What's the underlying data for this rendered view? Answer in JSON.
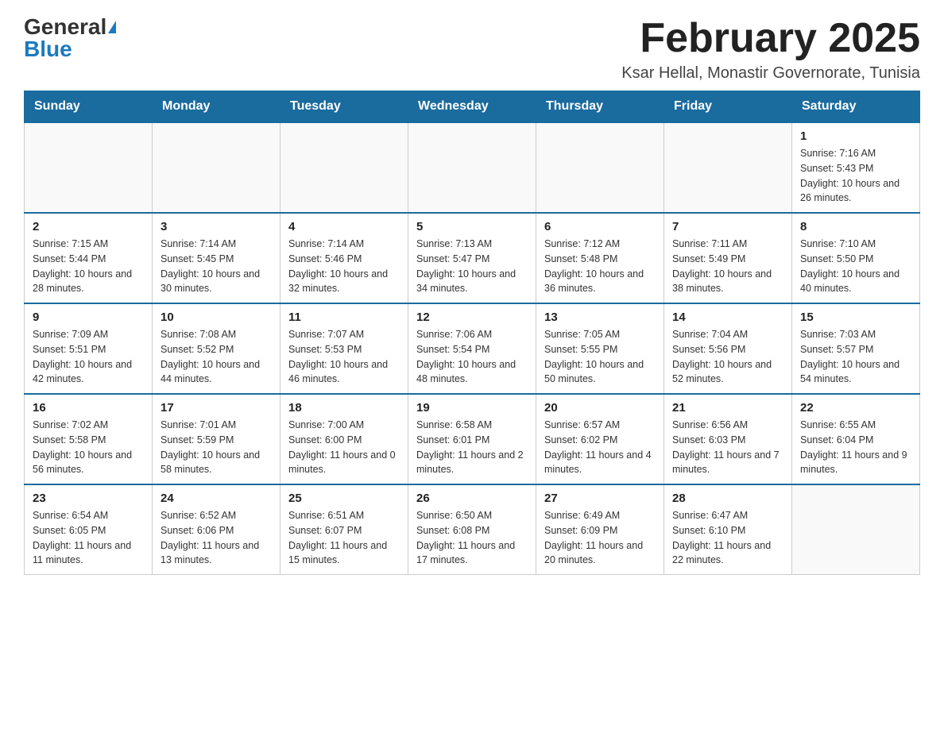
{
  "header": {
    "logo_general": "General",
    "logo_blue": "Blue",
    "month_year": "February 2025",
    "location": "Ksar Hellal, Monastir Governorate, Tunisia"
  },
  "days_of_week": [
    "Sunday",
    "Monday",
    "Tuesday",
    "Wednesday",
    "Thursday",
    "Friday",
    "Saturday"
  ],
  "weeks": [
    [
      {
        "day": "",
        "info": ""
      },
      {
        "day": "",
        "info": ""
      },
      {
        "day": "",
        "info": ""
      },
      {
        "day": "",
        "info": ""
      },
      {
        "day": "",
        "info": ""
      },
      {
        "day": "",
        "info": ""
      },
      {
        "day": "1",
        "info": "Sunrise: 7:16 AM\nSunset: 5:43 PM\nDaylight: 10 hours and 26 minutes."
      }
    ],
    [
      {
        "day": "2",
        "info": "Sunrise: 7:15 AM\nSunset: 5:44 PM\nDaylight: 10 hours and 28 minutes."
      },
      {
        "day": "3",
        "info": "Sunrise: 7:14 AM\nSunset: 5:45 PM\nDaylight: 10 hours and 30 minutes."
      },
      {
        "day": "4",
        "info": "Sunrise: 7:14 AM\nSunset: 5:46 PM\nDaylight: 10 hours and 32 minutes."
      },
      {
        "day": "5",
        "info": "Sunrise: 7:13 AM\nSunset: 5:47 PM\nDaylight: 10 hours and 34 minutes."
      },
      {
        "day": "6",
        "info": "Sunrise: 7:12 AM\nSunset: 5:48 PM\nDaylight: 10 hours and 36 minutes."
      },
      {
        "day": "7",
        "info": "Sunrise: 7:11 AM\nSunset: 5:49 PM\nDaylight: 10 hours and 38 minutes."
      },
      {
        "day": "8",
        "info": "Sunrise: 7:10 AM\nSunset: 5:50 PM\nDaylight: 10 hours and 40 minutes."
      }
    ],
    [
      {
        "day": "9",
        "info": "Sunrise: 7:09 AM\nSunset: 5:51 PM\nDaylight: 10 hours and 42 minutes."
      },
      {
        "day": "10",
        "info": "Sunrise: 7:08 AM\nSunset: 5:52 PM\nDaylight: 10 hours and 44 minutes."
      },
      {
        "day": "11",
        "info": "Sunrise: 7:07 AM\nSunset: 5:53 PM\nDaylight: 10 hours and 46 minutes."
      },
      {
        "day": "12",
        "info": "Sunrise: 7:06 AM\nSunset: 5:54 PM\nDaylight: 10 hours and 48 minutes."
      },
      {
        "day": "13",
        "info": "Sunrise: 7:05 AM\nSunset: 5:55 PM\nDaylight: 10 hours and 50 minutes."
      },
      {
        "day": "14",
        "info": "Sunrise: 7:04 AM\nSunset: 5:56 PM\nDaylight: 10 hours and 52 minutes."
      },
      {
        "day": "15",
        "info": "Sunrise: 7:03 AM\nSunset: 5:57 PM\nDaylight: 10 hours and 54 minutes."
      }
    ],
    [
      {
        "day": "16",
        "info": "Sunrise: 7:02 AM\nSunset: 5:58 PM\nDaylight: 10 hours and 56 minutes."
      },
      {
        "day": "17",
        "info": "Sunrise: 7:01 AM\nSunset: 5:59 PM\nDaylight: 10 hours and 58 minutes."
      },
      {
        "day": "18",
        "info": "Sunrise: 7:00 AM\nSunset: 6:00 PM\nDaylight: 11 hours and 0 minutes."
      },
      {
        "day": "19",
        "info": "Sunrise: 6:58 AM\nSunset: 6:01 PM\nDaylight: 11 hours and 2 minutes."
      },
      {
        "day": "20",
        "info": "Sunrise: 6:57 AM\nSunset: 6:02 PM\nDaylight: 11 hours and 4 minutes."
      },
      {
        "day": "21",
        "info": "Sunrise: 6:56 AM\nSunset: 6:03 PM\nDaylight: 11 hours and 7 minutes."
      },
      {
        "day": "22",
        "info": "Sunrise: 6:55 AM\nSunset: 6:04 PM\nDaylight: 11 hours and 9 minutes."
      }
    ],
    [
      {
        "day": "23",
        "info": "Sunrise: 6:54 AM\nSunset: 6:05 PM\nDaylight: 11 hours and 11 minutes."
      },
      {
        "day": "24",
        "info": "Sunrise: 6:52 AM\nSunset: 6:06 PM\nDaylight: 11 hours and 13 minutes."
      },
      {
        "day": "25",
        "info": "Sunrise: 6:51 AM\nSunset: 6:07 PM\nDaylight: 11 hours and 15 minutes."
      },
      {
        "day": "26",
        "info": "Sunrise: 6:50 AM\nSunset: 6:08 PM\nDaylight: 11 hours and 17 minutes."
      },
      {
        "day": "27",
        "info": "Sunrise: 6:49 AM\nSunset: 6:09 PM\nDaylight: 11 hours and 20 minutes."
      },
      {
        "day": "28",
        "info": "Sunrise: 6:47 AM\nSunset: 6:10 PM\nDaylight: 11 hours and 22 minutes."
      },
      {
        "day": "",
        "info": ""
      }
    ]
  ]
}
